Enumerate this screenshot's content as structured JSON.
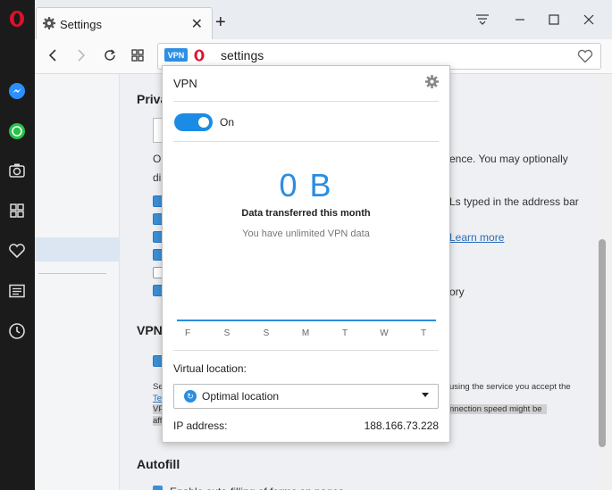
{
  "tab": {
    "title": "Settings",
    "close": "✕",
    "new_tab": "+"
  },
  "toolbar": {
    "vpn_badge": "VPN",
    "address": "settings"
  },
  "settings": {
    "privacy_heading": "Priva",
    "text_line1": "Op",
    "text_line1_right": "ence. You may optionally",
    "text_line2": "di",
    "option_right1": "Ls typed in the address bar",
    "learn_more": "Learn more",
    "option_right2": "ory",
    "checkboxes": [
      true,
      true,
      true,
      true,
      false,
      true
    ],
    "vpn_heading": "VPN",
    "vpn_checkbox": true,
    "vpn_small_left": "Se",
    "vpn_small_right": "using the service you accept the",
    "vpn_link_frag": "Te",
    "vpn_small_left2": "VP",
    "vpn_small_right2": "nnection speed might be",
    "vpn_small_left3": "aff",
    "autofill_heading": "Autofill",
    "autofill_cut": "Enable auto-filling of forms on pages"
  },
  "vpn_popup": {
    "title": "VPN",
    "toggle_label": "On",
    "toggle_on": true,
    "data_amount": "0 B",
    "data_caption": "Data transferred this month",
    "data_sub": "You have unlimited VPN data",
    "days": [
      "F",
      "S",
      "S",
      "M",
      "T",
      "W",
      "T"
    ],
    "location_label": "Virtual location:",
    "location_value": "Optimal location",
    "ip_label": "IP address:",
    "ip_value": "188.166.73.228"
  },
  "colors": {
    "accent": "#2b8de0",
    "sidebar": "#1b1b1b",
    "opera_red": "#e0112b"
  },
  "icons": [
    "opera-logo-icon",
    "messenger-icon",
    "whatsapp-icon",
    "camera-icon",
    "speed-dial-icon",
    "heart-icon",
    "news-icon",
    "history-icon",
    "gear-icon",
    "back-icon",
    "forward-icon",
    "reload-icon",
    "grid-icon",
    "bookmark-heart-icon",
    "menu-icon",
    "minimize-icon",
    "maximize-icon",
    "close-icon"
  ]
}
